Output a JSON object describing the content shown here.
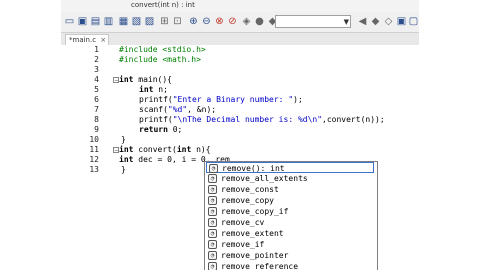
{
  "window": {
    "title": "convert(int n) : int"
  },
  "toolbar": {
    "icons": [
      "new-file",
      "open-folder",
      "save",
      "save-all",
      "compile",
      "run",
      "compile-run",
      "rebuild",
      "check-syntax",
      "debug",
      "stop",
      "zoom-in",
      "zoom-out",
      "search",
      "replace",
      "stop-execution",
      "compiler-dropdown",
      "bookmark-prev",
      "bookmark-next",
      "bookmark-toggle",
      "back"
    ]
  },
  "tabs": [
    {
      "label": "*main.c",
      "close": "×"
    }
  ],
  "editor": {
    "line_numbers": [
      "1",
      "2",
      "3",
      "4",
      "5",
      "6",
      "7",
      "8",
      "9",
      "10",
      "11",
      "12",
      "13"
    ]
  },
  "code": {
    "l1_pp": "#include <stdio.h>",
    "l2_pp": "#include <math.h>",
    "l4_kw": "int",
    "l4_rest": " main(){",
    "l5_kw": "int",
    "l5_rest": " n;",
    "l6_a": "printf(",
    "l6_str": "\"Enter a Binary number: \"",
    "l6_b": ");",
    "l7_a": "scanf(",
    "l7_str": "\"%d\"",
    "l7_b": ", &n);",
    "l8_a": "printf(",
    "l8_str": "\"\\nThe Decimal number is: %d\\n\"",
    "l8_b": ",convert(n));",
    "l9_kw": "return",
    "l9_rest": " 0;",
    "l10": "}",
    "l11_kw1": "int",
    "l11_rest1": " convert(",
    "l11_kw2": "int",
    "l11_rest2": " n){",
    "l12_kw": "int",
    "l12_rest": " dec = 0, i = 0, rem",
    "l13": "}"
  },
  "autocomplete": {
    "icon_glyph": "◔",
    "items": [
      "remove(): int",
      "remove_all_extents",
      "remove_const",
      "remove_copy",
      "remove_copy_if",
      "remove_cv",
      "remove_extent",
      "remove_if",
      "remove_pointer",
      "remove_reference"
    ]
  }
}
